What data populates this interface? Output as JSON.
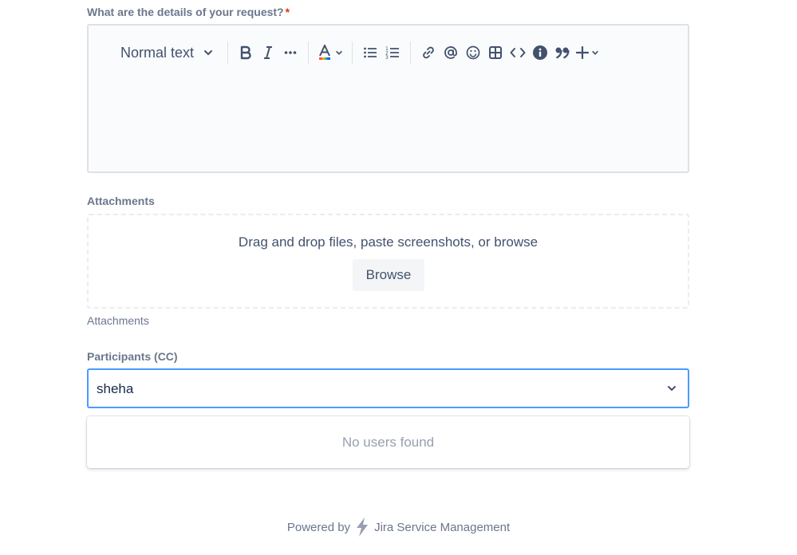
{
  "details": {
    "label": "What are the details of your request?",
    "required_mark": "*",
    "toolbar": {
      "text_style": "Normal text",
      "buttons": {
        "bold": "bold-icon",
        "italic": "italic-icon",
        "more_formatting": "more-icon",
        "text_color": "text-color-icon",
        "bullet_list": "bullet-list-icon",
        "numbered_list": "numbered-list-icon",
        "link": "link-icon",
        "mention": "mention-icon",
        "emoji": "emoji-icon",
        "table": "table-icon",
        "code": "code-icon",
        "info_panel": "info-icon",
        "quote": "quote-icon",
        "insert": "plus-icon"
      }
    }
  },
  "attachments": {
    "label": "Attachments",
    "drop_text": "Drag and drop files, paste screenshots, or browse",
    "browse_label": "Browse",
    "helper": "Attachments"
  },
  "participants": {
    "label": "Participants (CC)",
    "value": "sheha",
    "no_results": "No users found"
  },
  "footer": {
    "prefix": "Powered by",
    "product": "Jira Service Management"
  },
  "colors": {
    "label": "#6b778c",
    "required": "#de350b",
    "focus": "#4c9aff",
    "editor_bg": "#fafbfc"
  }
}
